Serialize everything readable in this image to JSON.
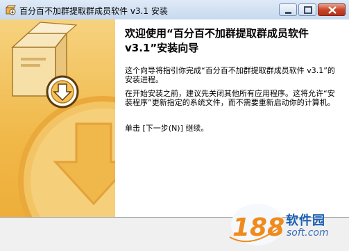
{
  "window": {
    "title": "百分百不加群提取群成员软件 v3.1 安装"
  },
  "content": {
    "heading": "欢迎使用“百分百不加群提取群成员软件 v3.1”安装向导",
    "para1": "这个向导将指引你完成“百分百不加群提取群成员软件 v3.1”的安装进程。",
    "para2": "在开始安装之前，建议先关闭其他所有应用程序。这将允许“安装程序”更新指定的系统文件，而不需要重新启动你的计算机。",
    "para3": "单击 [下一步(N)] 继续。"
  },
  "watermark": {
    "number": "188",
    "name": "软件园",
    "domain": "soft.com"
  },
  "icons": {
    "app": "installer-box-icon",
    "minimize": "minimize-icon",
    "maximize": "maximize-icon",
    "close": "close-icon"
  },
  "colors": {
    "banner_orange": "#f0b848",
    "titlebar_blue": "#c7d9ef",
    "close_red": "#c7452a",
    "watermark_blue": "#1a5fb4"
  }
}
